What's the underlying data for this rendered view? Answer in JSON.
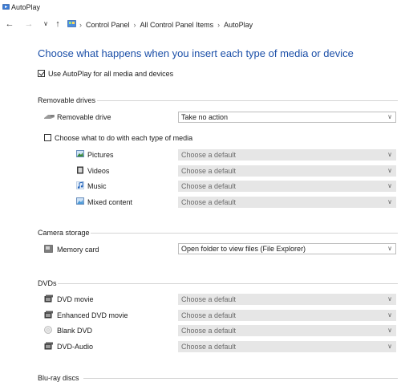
{
  "window": {
    "title": "AutoPlay"
  },
  "breadcrumb": [
    "Control Panel",
    "All Control Panel Items",
    "AutoPlay"
  ],
  "heading": "Choose what happens when you insert each type of media or device",
  "use_autoplay": {
    "label": "Use AutoPlay for all media and devices",
    "checked": true
  },
  "removable": {
    "section_title": "Removable drives",
    "drive": {
      "label": "Removable drive",
      "value": "Take no action"
    },
    "per_type_checkbox": {
      "label": "Choose what to do with each type of media",
      "checked": false
    },
    "types": [
      {
        "label": "Pictures",
        "value": "Choose a default"
      },
      {
        "label": "Videos",
        "value": "Choose a default"
      },
      {
        "label": "Music",
        "value": "Choose a default"
      },
      {
        "label": "Mixed content",
        "value": "Choose a default"
      }
    ]
  },
  "camera": {
    "section_title": "Camera storage",
    "memory_card": {
      "label": "Memory card",
      "value": "Open folder to view files (File Explorer)"
    }
  },
  "dvds": {
    "section_title": "DVDs",
    "items": [
      {
        "label": "DVD movie",
        "value": "Choose a default"
      },
      {
        "label": "Enhanced DVD movie",
        "value": "Choose a default"
      },
      {
        "label": "Blank DVD",
        "value": "Choose a default"
      },
      {
        "label": "DVD-Audio",
        "value": "Choose a default"
      }
    ]
  },
  "bluray": {
    "section_title": "Blu-ray discs"
  },
  "colors": {
    "accent": "#1b4fa8",
    "rule": "#d4d4d4",
    "disabled_dropdown": "#e6e6e6"
  }
}
